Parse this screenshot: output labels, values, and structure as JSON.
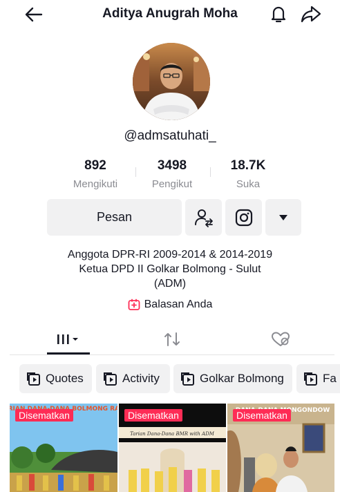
{
  "header": {
    "title": "Aditya Anugrah Moha",
    "back_icon": "arrow-left-icon",
    "bell_icon": "bell-icon",
    "share_icon": "share-arrow-icon"
  },
  "profile": {
    "username": "@admsatuhati_",
    "stats": [
      {
        "value": "892",
        "label": "Mengikuti"
      },
      {
        "value": "3498",
        "label": "Pengikut"
      },
      {
        "value": "18.7K",
        "label": "Suka"
      }
    ],
    "bio_lines": [
      "Anggota DPR-RI 2009-2014 & 2014-2019",
      "Ketua DPD II Golkar Bolmong - Sulut",
      "(ADM)"
    ],
    "reply_label": "Balasan Anda"
  },
  "actions": {
    "message_label": "Pesan"
  },
  "playlists": [
    {
      "label": "Quotes"
    },
    {
      "label": "Activity"
    },
    {
      "label": "Golkar Bolmong"
    },
    {
      "label": "Fa"
    }
  ],
  "videos": [
    {
      "pinned_label": "Disematkan",
      "overlay_text": "TARIAN DANA-DANA BOLMONG RAYA"
    },
    {
      "pinned_label": "Disematkan",
      "overlay_text": "Tarian Dana-Dana BMR with ADM"
    },
    {
      "pinned_label": "Disematkan",
      "overlay_text": "DANA-DANA MONGONDOW"
    }
  ],
  "colors": {
    "accent": "#fe2c55",
    "text": "#161823",
    "muted": "#8a8b91",
    "button_bg": "#f1f1f2"
  }
}
